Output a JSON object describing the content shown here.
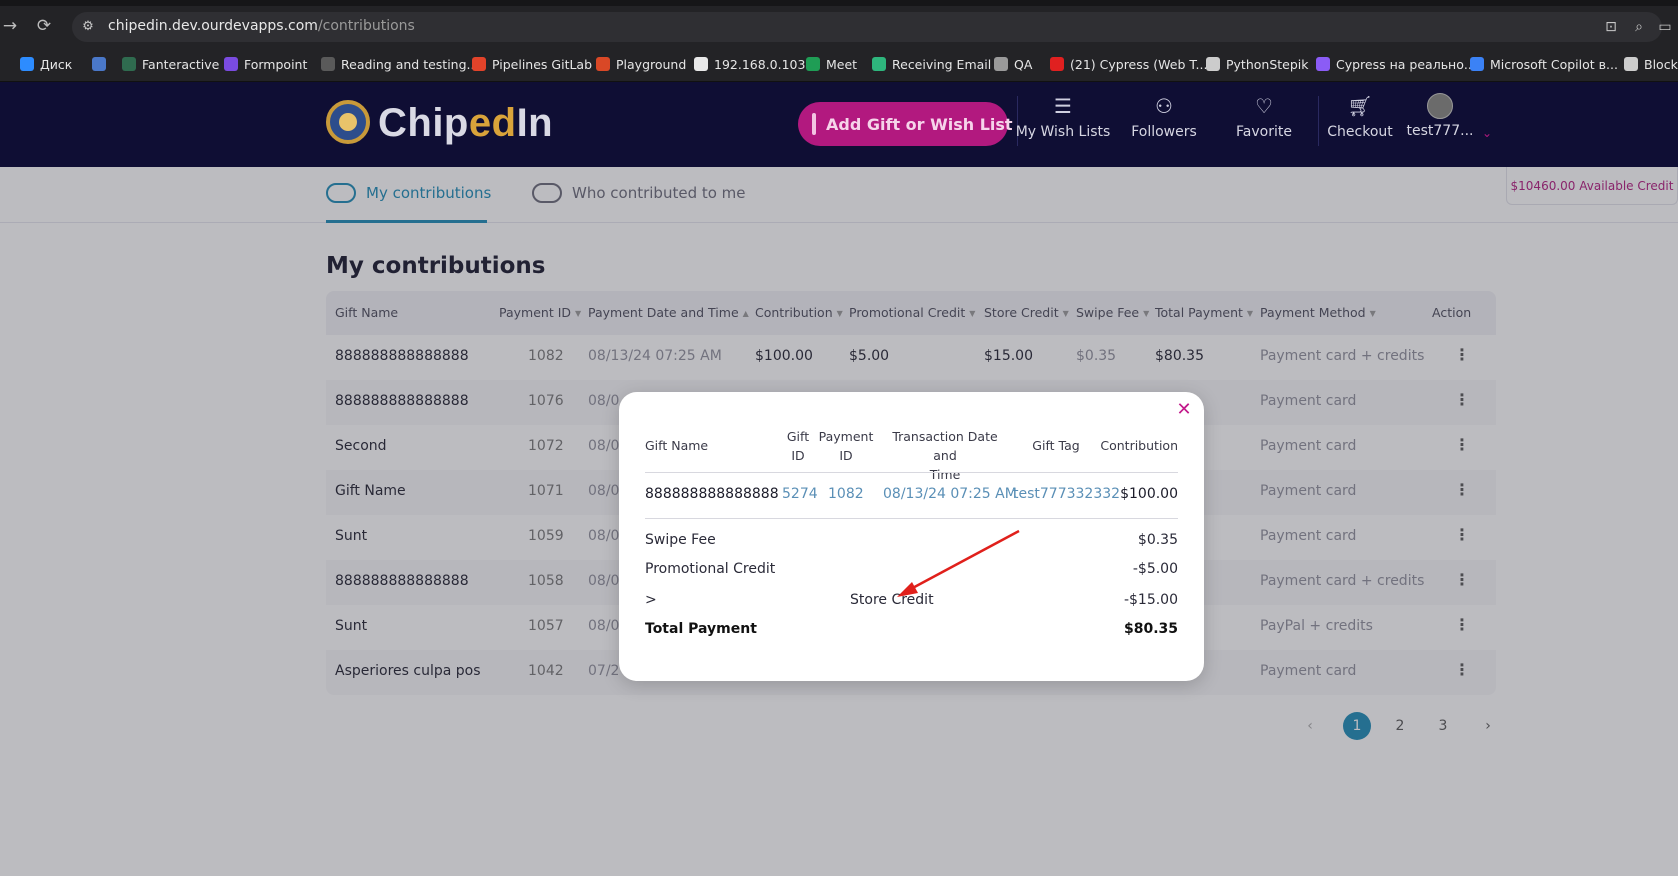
{
  "browser": {
    "url_host": "chipedin.dev.ourdevapps.com",
    "url_path": "/contributions",
    "bookmarks": [
      {
        "label": "Диск",
        "color": "#2d8cff"
      },
      {
        "label": "",
        "color": "#4a78c9"
      },
      {
        "label": "Fanteractive",
        "color": "#2f6b4f"
      },
      {
        "label": "Formpoint",
        "color": "#7a4be0"
      },
      {
        "label": "Reading and testing...",
        "color": "#5a5a5a"
      },
      {
        "label": "Pipelines GitLab",
        "color": "#e2432a"
      },
      {
        "label": "Playground",
        "color": "#d94826"
      },
      {
        "label": "192.168.0.103",
        "color": "#e8e8e8"
      },
      {
        "label": "Meet",
        "color": "#1f9d55"
      },
      {
        "label": "Receiving Email",
        "color": "#2eb67d"
      },
      {
        "label": "QA",
        "color": "#9a9a9a"
      },
      {
        "label": "(21) Cypress (Web T...",
        "color": "#e02020"
      },
      {
        "label": "PythonStepik",
        "color": "#cccccc"
      },
      {
        "label": "Cypress на реально...",
        "color": "#8b5cf6"
      },
      {
        "label": "Microsoft Copilot в...",
        "color": "#3b82f6"
      },
      {
        "label": "Block",
        "color": "#cccccc"
      }
    ]
  },
  "header": {
    "logo_prefix": "Chip",
    "logo_accent": "ed",
    "logo_suffix": "In",
    "add_button": "Add Gift or Wish List",
    "nav": [
      {
        "label": "My Wish Lists",
        "icon": "list-icon"
      },
      {
        "label": "Followers",
        "icon": "followers-icon"
      },
      {
        "label": "Favorite",
        "icon": "heart-icon"
      },
      {
        "label": "Checkout",
        "icon": "cart-icon"
      },
      {
        "label": "test777...",
        "icon": "avatar"
      }
    ]
  },
  "tabs": {
    "active": "My contributions",
    "inactive": "Who contributed to me"
  },
  "credit_badge": "$10460.00 Available Credit",
  "page_title": "My contributions",
  "table": {
    "headers": [
      "Gift Name",
      "Payment ID",
      "Payment Date and Time",
      "Contribution",
      "Promotional Credit",
      "Store Credit",
      "Swipe Fee",
      "Total Payment",
      "Payment Method",
      "Action"
    ],
    "rows": [
      {
        "gift": "888888888888888",
        "pid": "1082",
        "date": "08/13/24 07:25 AM",
        "contribution": "$100.00",
        "promo": "$5.00",
        "store": "$15.00",
        "fee": "$0.35",
        "total": "$80.35",
        "method": "Payment card + credits"
      },
      {
        "gift": "888888888888888",
        "pid": "1076",
        "date": "08/0",
        "contribution": "",
        "promo": "",
        "store": "",
        "fee": "",
        "total": "",
        "method": "Payment card"
      },
      {
        "gift": "Second",
        "pid": "1072",
        "date": "08/0",
        "contribution": "",
        "promo": "",
        "store": "",
        "fee": "",
        "total": "",
        "method": "Payment card"
      },
      {
        "gift": "Gift Name",
        "pid": "1071",
        "date": "08/0",
        "contribution": "",
        "promo": "",
        "store": "",
        "fee": "",
        "total": "",
        "method": "Payment card"
      },
      {
        "gift": "Sunt",
        "pid": "1059",
        "date": "08/0",
        "contribution": "",
        "promo": "",
        "store": "",
        "fee": "",
        "total": "09",
        "method": "Payment card"
      },
      {
        "gift": "888888888888888",
        "pid": "1058",
        "date": "08/0",
        "contribution": "",
        "promo": "",
        "store": "",
        "fee": "",
        "total": "",
        "method": "Payment card + credits"
      },
      {
        "gift": "Sunt",
        "pid": "1057",
        "date": "08/0",
        "contribution": "",
        "promo": "",
        "store": "",
        "fee": "",
        "total": "",
        "method": "PayPal + credits"
      },
      {
        "gift": "Asperiores culpa pos",
        "pid": "1042",
        "date": "07/2",
        "contribution": "",
        "promo": "",
        "store": "",
        "fee": "",
        "total": "4",
        "method": "Payment card"
      }
    ]
  },
  "pagination": {
    "pages": [
      "1",
      "2",
      "3"
    ],
    "current": "1",
    "prev": "‹",
    "next": "›"
  },
  "modal": {
    "headers": {
      "gift_name": "Gift Name",
      "gift_id_1": "Gift",
      "gift_id_2": "ID",
      "payment_id_1": "Payment",
      "payment_id_2": "ID",
      "txn_1": "Transaction Date and",
      "txn_2": "Time",
      "gift_tag": "Gift Tag",
      "contribution": "Contribution"
    },
    "row": {
      "gift_name": "888888888888888",
      "gift_id": "5274",
      "payment_id": "1082",
      "txn": "08/13/24 07:25 AM",
      "gift_tag": "test777332332",
      "contribution": "$100.00"
    },
    "summary": {
      "swipe_fee_label": "Swipe Fee",
      "swipe_fee": "$0.35",
      "promo_label": "Promotional Credit",
      "promo": "-$5.00",
      "store_prefix": ">",
      "store_label": "Store Credit",
      "store": "-$15.00",
      "total_label": "Total Payment",
      "total": "$80.35"
    }
  },
  "colors": {
    "header_bg": "#0f0e34",
    "accent_magenta": "#b2197f",
    "accent_blue": "#1a8ab6",
    "annotation_red": "#e0201b"
  }
}
